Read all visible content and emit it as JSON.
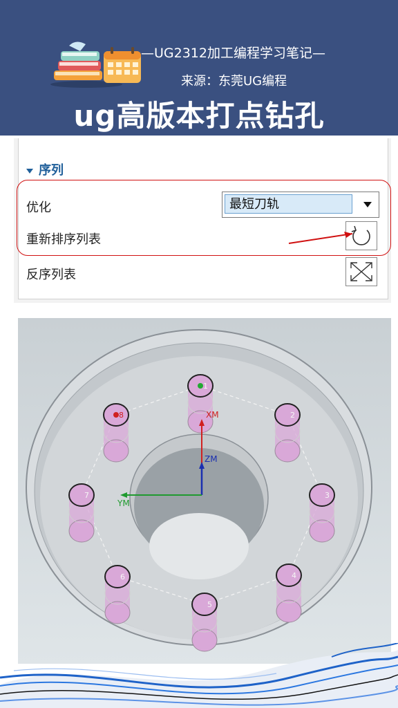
{
  "banner": {
    "subtitle": "—UG2312加工编程学习笔记—",
    "source": "来源：东莞UG编程",
    "title": "ug高版本打点钻孔"
  },
  "panel": {
    "section_title": "序列",
    "optimize_label": "优化",
    "optimize_value": "最短刀轨",
    "reorder_label": "重新排序列表",
    "reverse_label": "反序列表"
  },
  "viewport": {
    "axis_xm": "XM",
    "axis_ym": "YM",
    "axis_zm": "ZM",
    "hole_numbers": [
      "1",
      "2",
      "3",
      "4",
      "5",
      "6",
      "7",
      "8"
    ]
  },
  "colors": {
    "banner": "#3a5080",
    "section": "#1f5f9a",
    "highlight": "#d01010",
    "hole": "#d9a8d8"
  },
  "icons": [
    "books-calendar-logo",
    "dropdown-arrow",
    "reorder-icon",
    "reverse-icon",
    "arrow-annotation"
  ]
}
